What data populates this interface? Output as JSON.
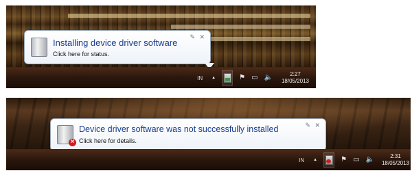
{
  "notifications": [
    {
      "title": "Installing device driver software",
      "subtitle": "Click here for status.",
      "pin_icon": "pin-icon",
      "close_icon": "close-icon",
      "device_icon": "device-driver-icon",
      "status": "installing"
    },
    {
      "title": "Device driver software was not successfully installed",
      "subtitle": "Click here for details.",
      "pin_icon": "pin-icon",
      "close_icon": "close-icon",
      "device_icon": "device-driver-error-icon",
      "status": "failed"
    }
  ],
  "taskbars": [
    {
      "language": "IN",
      "overflow_glyph": "▲",
      "pin_glyph": "✎",
      "close_glyph": "✕",
      "flag_glyph": "⚑",
      "network_glyph": "▭",
      "volume_glyph": "🔈",
      "time": "2:27",
      "date": "18/05/2013"
    },
    {
      "language": "IN",
      "overflow_glyph": "▲",
      "pin_glyph": "✎",
      "close_glyph": "✕",
      "flag_glyph": "⚑",
      "network_glyph": "▭",
      "volume_glyph": "🔈",
      "time": "2:31",
      "date": "18/05/2013"
    }
  ]
}
